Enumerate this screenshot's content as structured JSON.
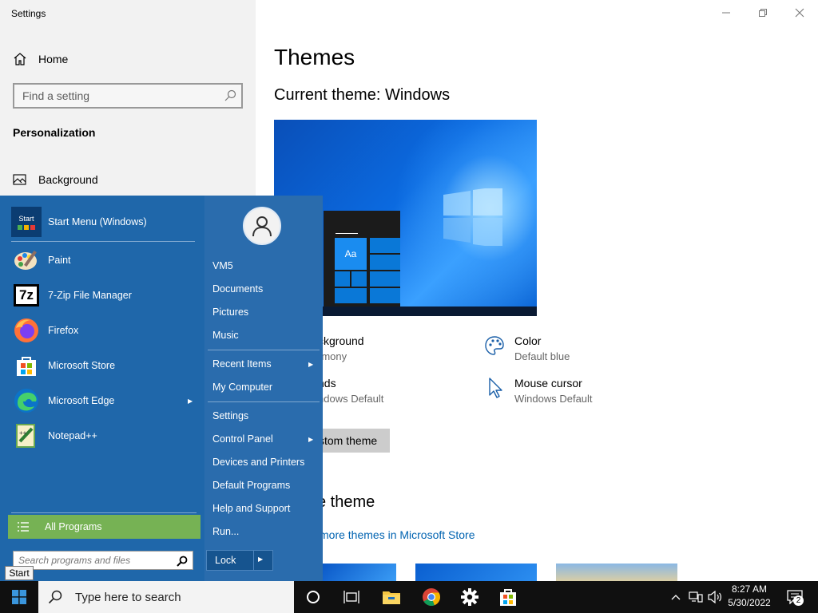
{
  "window": {
    "title": "Settings"
  },
  "sidebar": {
    "home_label": "Home",
    "search_placeholder": "Find a setting",
    "section_title": "Personalization",
    "items": [
      {
        "label": "Background",
        "icon": "image-icon"
      }
    ]
  },
  "main": {
    "title": "Themes",
    "current_theme": "Current theme: Windows",
    "preview_tile_text": "Aa",
    "properties": [
      {
        "label": "ckground",
        "value": "rmony",
        "icon": "image-icon"
      },
      {
        "label": "Color",
        "value": "Default blue",
        "icon": "palette-icon"
      },
      {
        "label": "nds",
        "value": "ndows Default",
        "icon": "speaker-icon"
      },
      {
        "label": "Mouse cursor",
        "value": "Windows Default",
        "icon": "cursor-icon"
      }
    ],
    "save_button": "stom theme",
    "apply_title": "e theme",
    "store_link": "more themes in Microsoft Store"
  },
  "start_menu": {
    "pinned": [
      {
        "label": "Start Menu (Windows)",
        "icon": "start-menu-app-icon"
      },
      {
        "label": "Paint",
        "icon": "paint-icon"
      },
      {
        "label": "7-Zip File Manager",
        "icon": "7zip-icon"
      },
      {
        "label": "Firefox",
        "icon": "firefox-icon"
      },
      {
        "label": "Microsoft Store",
        "icon": "store-icon"
      },
      {
        "label": "Microsoft Edge",
        "icon": "edge-icon"
      },
      {
        "label": "Notepad++",
        "icon": "notepadpp-icon"
      }
    ],
    "start_icon_text": "Start",
    "all_programs": "All Programs",
    "search_placeholder": "Search programs and files",
    "right_links": {
      "user": "VM5",
      "documents": "Documents",
      "pictures": "Pictures",
      "music": "Music",
      "recent_items": "Recent Items",
      "my_computer": "My Computer",
      "settings": "Settings",
      "control_panel": "Control Panel",
      "devices_printers": "Devices and Printers",
      "default_programs": "Default Programs",
      "help_support": "Help and Support",
      "run": "Run..."
    },
    "lock_label": "Lock",
    "tooltip": "Start"
  },
  "taskbar": {
    "search_placeholder": "Type here to search",
    "time": "8:27 AM",
    "date": "5/30/2022",
    "notification_count": "2"
  },
  "colors": {
    "start_menu_bg": "#1f67aa",
    "all_programs_bg": "#76b254",
    "taskbar_bg": "#101010",
    "accent": "#0078d7",
    "link": "#0063b1"
  }
}
